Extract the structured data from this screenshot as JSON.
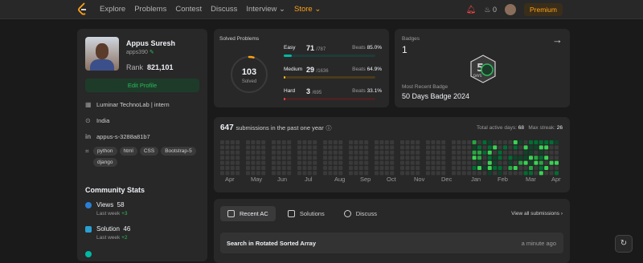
{
  "nav": {
    "links": [
      "Explore",
      "Problems",
      "Contest",
      "Discuss",
      "Interview ⌄",
      "Store ⌄"
    ],
    "notifications": "",
    "streak": "0",
    "premium": "Premium"
  },
  "profile": {
    "name": "Appus Suresh",
    "username": "apps390",
    "rank_label": "Rank",
    "rank_value": "821,101",
    "edit": "Edit Profile",
    "org": "Luminar TechnoLab | intern",
    "location": "India",
    "linkedin": "appus-s-3288a81b7",
    "skills": [
      "python",
      "html",
      "CSS",
      "Bootstrap-5",
      "django"
    ]
  },
  "community": {
    "title": "Community Stats",
    "views_label": "Views",
    "views_value": "58",
    "views_week": "Last week",
    "views_delta": "+3",
    "solution_label": "Solution",
    "solution_value": "46",
    "solution_week": "Last week",
    "solution_delta": "+2"
  },
  "solved": {
    "title": "Solved Problems",
    "total": "103",
    "total_label": "Solved",
    "easy": {
      "name": "Easy",
      "count": "71",
      "of": "/787",
      "beats_label": "Beats",
      "beats": "85.0%",
      "fill": 0.09
    },
    "medium": {
      "name": "Medium",
      "count": "29",
      "of": "/1636",
      "beats_label": "Beats",
      "beats": "64.9%",
      "fill": 0.018
    },
    "hard": {
      "name": "Hard",
      "count": "3",
      "of": "/695",
      "beats_label": "Beats",
      "beats": "33.1%",
      "fill": 0.004
    },
    "colors": {
      "easy": "#00b8a3",
      "medium": "#ffc01e",
      "hard": "#ef4743"
    }
  },
  "badges": {
    "label": "Badges",
    "count": "1",
    "recent_label": "Most Recent Badge",
    "recent_name": "50 Days Badge 2024",
    "badge_text": "DAYS"
  },
  "submissions": {
    "count": "647",
    "text": "submissions in the past one year",
    "active_label": "Total active days:",
    "active_value": "68",
    "streak_label": "Max streak:",
    "streak_value": "26",
    "months": [
      "Apr",
      "May",
      "Jun",
      "Jul",
      "Aug",
      "Sep",
      "Oct",
      "Nov",
      "Dec",
      "Jan",
      "Feb",
      "Mar",
      "Apr"
    ]
  },
  "recent": {
    "tabs": [
      "Recent AC",
      "Solutions",
      "Discuss"
    ],
    "view_all": "View all submissions  ›",
    "first_title": "Search in Rotated Sorted Array",
    "first_time": "a minute ago"
  }
}
